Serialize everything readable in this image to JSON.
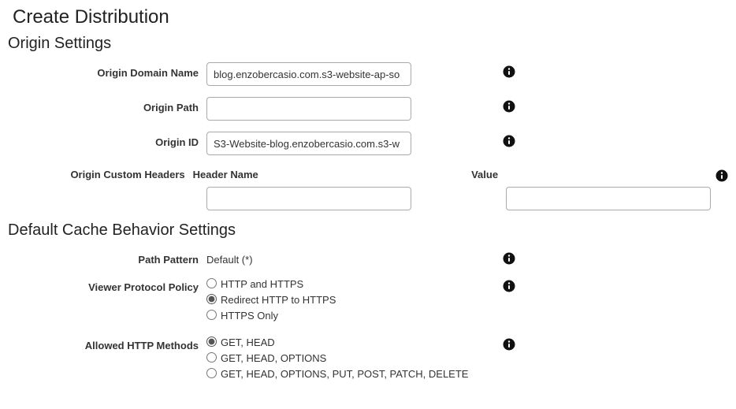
{
  "page": {
    "title": "Create Distribution"
  },
  "origin": {
    "section_title": "Origin Settings",
    "domain_name": {
      "label": "Origin Domain Name",
      "value": "blog.enzobercasio.com.s3-website-ap-so"
    },
    "path": {
      "label": "Origin Path",
      "value": ""
    },
    "id": {
      "label": "Origin ID",
      "value": "S3-Website-blog.enzobercasio.com.s3-w"
    },
    "custom_headers": {
      "label": "Origin Custom Headers",
      "header_name_label": "Header Name",
      "value_label": "Value",
      "header_name_value": "",
      "value_value": ""
    }
  },
  "cache": {
    "section_title": "Default Cache Behavior Settings",
    "path_pattern": {
      "label": "Path Pattern",
      "value": "Default (*)"
    },
    "viewer_protocol": {
      "label": "Viewer Protocol Policy",
      "options": [
        "HTTP and HTTPS",
        "Redirect HTTP to HTTPS",
        "HTTPS Only"
      ],
      "selected_index": 1
    },
    "allowed_methods": {
      "label": "Allowed HTTP Methods",
      "options": [
        "GET, HEAD",
        "GET, HEAD, OPTIONS",
        "GET, HEAD, OPTIONS, PUT, POST, PATCH, DELETE"
      ],
      "selected_index": 0
    }
  }
}
